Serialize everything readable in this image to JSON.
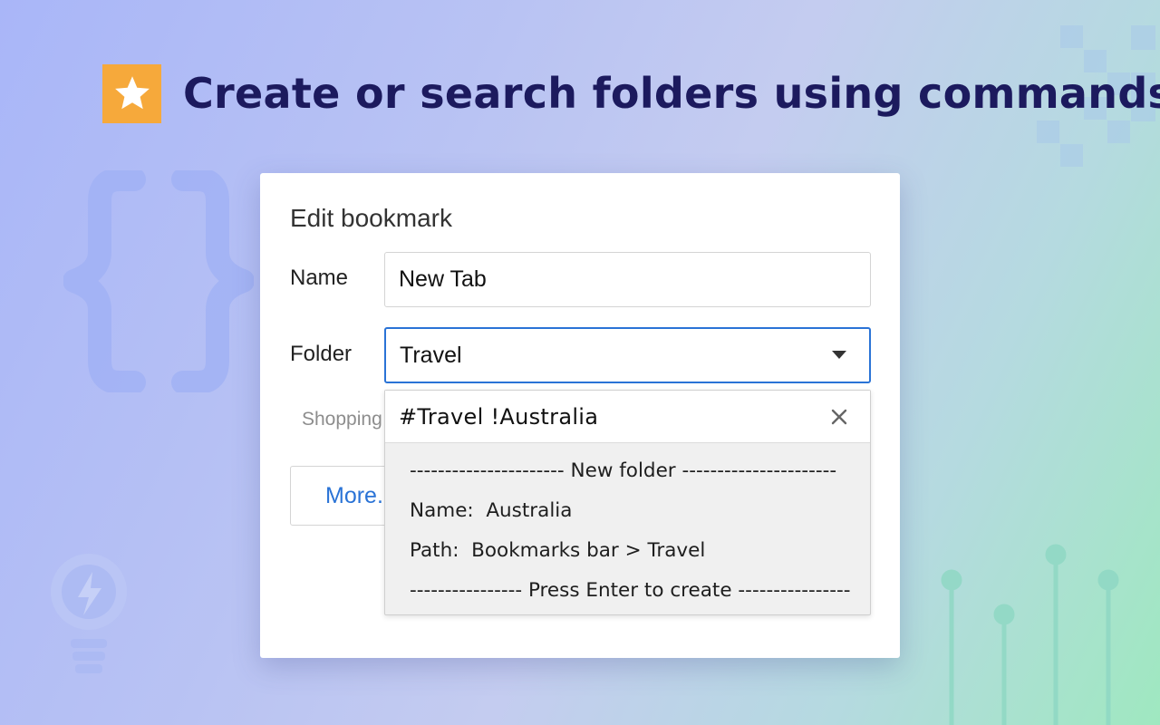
{
  "header": {
    "title": "Create or search folders using commands",
    "badge_icon": "star-icon",
    "badge_color": "#f6a93b"
  },
  "dialog": {
    "title": "Edit bookmark",
    "name_label": "Name",
    "name_value": "New Tab",
    "folder_label": "Folder",
    "folder_value": "Travel",
    "folder_caret_icon": "caret-down-icon",
    "suggestion": "Shopping",
    "more_button": "More..."
  },
  "dropdown": {
    "command": "#Travel !Australia",
    "clear_icon": "close-icon",
    "line1": "---------------------- New folder ----------------------",
    "line2": "Name:  Australia",
    "line3": "Path:  Bookmarks bar > Travel",
    "line4": "---------------- Press Enter to create ----------------"
  },
  "colors": {
    "accent": "#2a73d6",
    "headline": "#1c1a5e"
  }
}
